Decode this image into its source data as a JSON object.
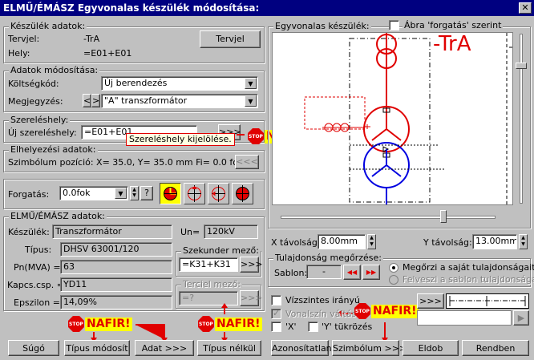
{
  "window": {
    "title": "ELMŰ/ÉMÁSZ Egyvonalas készülék módosítása:",
    "close_glyph": "✕"
  },
  "device_data": {
    "legend": "Készülék adatok:",
    "terv_label": "Tervjel:",
    "terv_value": "-TrA",
    "terv_button": "Tervjel",
    "hely_label": "Hely:",
    "hely_value": "=E01+E01"
  },
  "modify": {
    "legend": "Adatok módosítása:",
    "cost_label": "Költségkód:",
    "cost_value": "Új berendezés",
    "note_label": "Megjegyzés:",
    "note_value": "\"A\" transzformátor",
    "prev_glyph": "<",
    "next_glyph": ">"
  },
  "location": {
    "legend": "Szereléshely:",
    "new_label": "Új szereléshely:",
    "new_value": "=E01+E01",
    "pick_button": ">>>",
    "tooltip": "Szereléshely kijelölése."
  },
  "placement": {
    "legend": "Elhelyezési adatok:",
    "pos_text": "Szimbólum pozíció: X=  35.0, Y=  35.0 mm Fi=    0.0 fok",
    "pick_button": "<<<"
  },
  "rotation": {
    "label": "Forgatás:",
    "value": "0.0fok",
    "help": "?"
  },
  "elmu": {
    "legend": "ELMŰ/ÉMÁSZ adatok:",
    "device_label": "Készülék:",
    "device_value": "Transzformátor",
    "un_label": "Un=",
    "un_value": "120kV",
    "type_label": "Típus:",
    "type_value": "DHSV 63001/120",
    "pn_label": "Pn(MVA) =",
    "pn_value": "63",
    "kapcs_label": "Kapcs.csp. =",
    "kapcs_value": "YD11",
    "eps_label": "Epszilon =",
    "eps_value": "14,09%",
    "sec_legend": "Szekunder mező:",
    "sec_value": "=K31+K31",
    "sec_button": ">>>",
    "ter_legend": "Terciel mező:",
    "ter_value": "=?",
    "ter_button": ">>>"
  },
  "nafir": {
    "text": "NAFIR!",
    "stop": "STOP"
  },
  "preview": {
    "legend": "Egyvonalas készülék:",
    "rotate_check": "Ábra 'forgatás' szerint",
    "symbol_label": "-TrA",
    "x_label": "X távolság:",
    "x_value": "8.00mm",
    "y_label": "Y távolság:",
    "y_value": "13.00mm"
  },
  "props": {
    "legend": "Tulajdonság megőrzése:",
    "sablon_label": "Sablon:",
    "sablon_value": "-",
    "radio1": "Megőrzi a saját tulajdonságait",
    "radio2": "Felveszi a sablon tulajdonságait",
    "rew_glyph": "◀◀",
    "fwd_glyph": "▶▶"
  },
  "options": {
    "horizontal": "Vízszintes irányú",
    "color": "Vonalszín váltás",
    "xmirror": "'X'",
    "ymirror": "'Y' tükrözés",
    "more_button": ">>>"
  },
  "buttons": {
    "help": "Súgó",
    "type_mod": "Típus módosít",
    "data": "Adat >>>",
    "no_type": "Típus nélkül",
    "unidentified": "Azonosítatlan",
    "symbol": "Szimbólum >>>",
    "discard": "Eldob",
    "ok": "Rendben"
  },
  "colors": {
    "accent": "#000080",
    "nafir_red": "#e00000",
    "nafir_yellow": "#ffff00",
    "symbol_blue": "#0000e0"
  }
}
